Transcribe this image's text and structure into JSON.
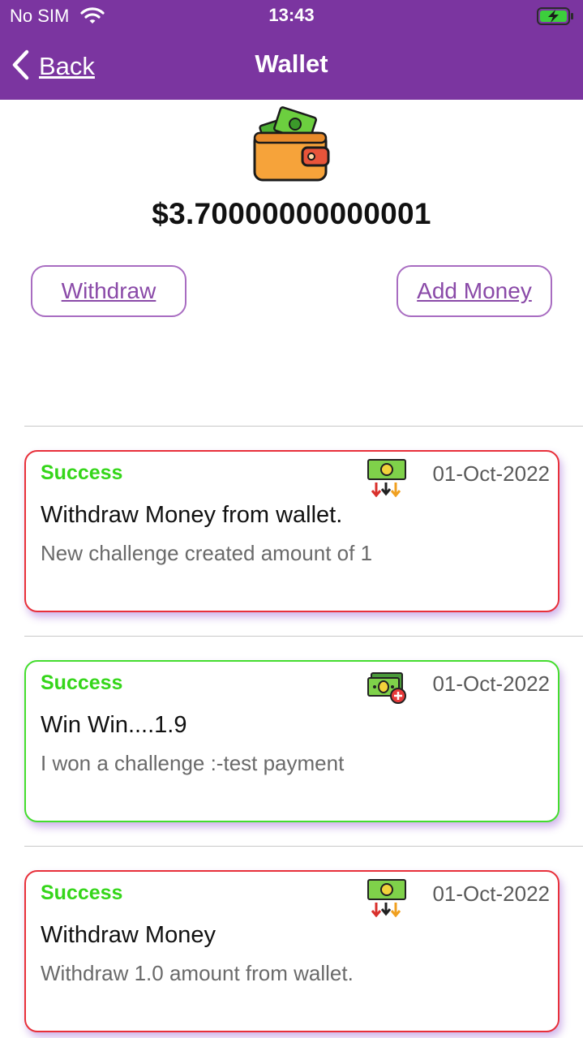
{
  "status_bar": {
    "carrier": "No SIM",
    "time": "13:43",
    "wifi_icon": "wifi-icon",
    "battery_icon": "battery-charging-icon"
  },
  "navbar": {
    "back_label": "Back",
    "back_icon": "chevron-left-icon",
    "title": "Wallet",
    "background_color": "#7b35a0"
  },
  "wallet": {
    "icon": "wallet-icon",
    "balance": "$3.70000000000001",
    "withdraw_label": "Withdraw",
    "add_money_label": "Add Money"
  },
  "transactions": [
    {
      "status": "Success",
      "type_icon": "cash-withdraw-icon",
      "date": "01-Oct-2022",
      "title": "Withdraw Money from wallet.",
      "description": "New challenge created amount of 1",
      "border_color": "#e8303a"
    },
    {
      "status": "Success",
      "type_icon": "cash-add-icon",
      "date": "01-Oct-2022",
      "title": "Win Win....1.9",
      "description": "I won a challenge :-test payment",
      "border_color": "#44dd2e"
    },
    {
      "status": "Success",
      "type_icon": "cash-withdraw-icon",
      "date": "01-Oct-2022",
      "title": "Withdraw Money",
      "description": "Withdraw 1.0 amount from wallet.",
      "border_color": "#e8303a"
    }
  ],
  "colors": {
    "status_success": "#35d61a",
    "button_text": "#8a4aa8",
    "button_border": "#a86cc1"
  }
}
